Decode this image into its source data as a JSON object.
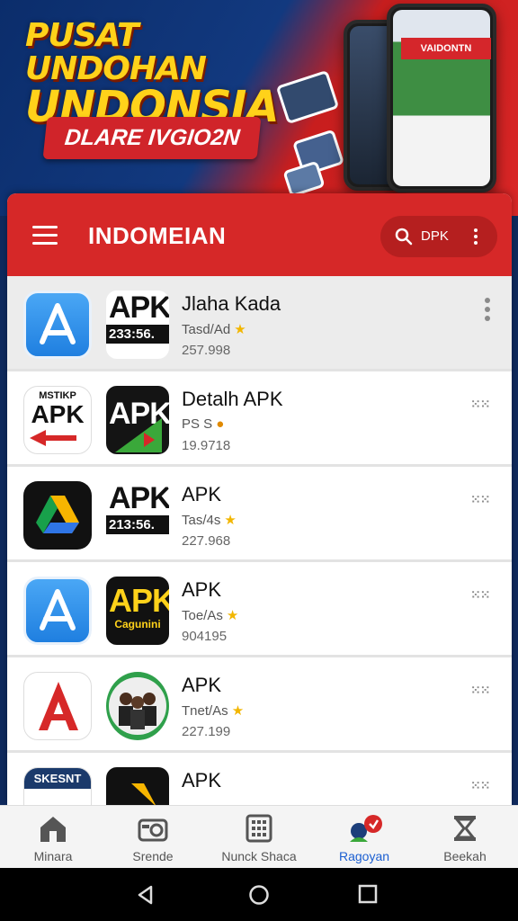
{
  "banner": {
    "title_line1": "PUSAT UNDOHAN",
    "title_line2": "UNDONSIA",
    "pill": "DLARE IVGIO2N",
    "phone_brand": "VAIDONTN"
  },
  "header": {
    "title": "INDOMEIAN",
    "search_text": "DPK"
  },
  "apps": [
    {
      "title": "Jlaha Kada",
      "sub": "Tasd/Ad",
      "num": "257.998",
      "badge_text": "APK",
      "badge_bar": "233:56."
    },
    {
      "title": "Detalh APK",
      "sub": "PS S",
      "num": "19.9718",
      "badge_text": "APK",
      "badge_bar": ""
    },
    {
      "title": "APK",
      "sub": "Tas/4s",
      "num": "227.968",
      "badge_text": "APK",
      "badge_bar": "213:56."
    },
    {
      "title": "APK",
      "sub": "Toe/As",
      "num": "904195",
      "badge_text": "APK",
      "badge_bar": "Cagunini"
    },
    {
      "title": "APK",
      "sub": "Tnet/As",
      "num": "227.199",
      "badge_text": "",
      "badge_bar": ""
    },
    {
      "title": "APK",
      "sub": "",
      "num": "",
      "badge_text": "",
      "badge_bar": ""
    }
  ],
  "icon_texts": {
    "row2_left_top": "MSTIKP",
    "row2_left_apk": "APK",
    "row6_left": "SKESNT"
  },
  "nav": [
    {
      "label": "Minara",
      "icon": "home-icon"
    },
    {
      "label": "Srende",
      "icon": "camera-icon"
    },
    {
      "label": "Nunck Shaca",
      "icon": "grid-icon"
    },
    {
      "label": "Ragoyan",
      "icon": "community-icon"
    },
    {
      "label": "Beekah",
      "icon": "hourglass-icon"
    }
  ],
  "colors": {
    "header_red": "#d62828",
    "banner_yellow": "#ffd21a",
    "nav_active": "#1c5fd1",
    "star": "#f2b600"
  }
}
